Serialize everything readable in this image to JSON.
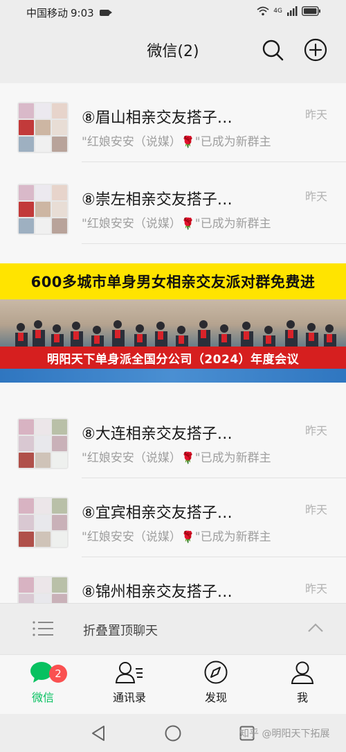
{
  "status_bar": {
    "carrier": "中国移动",
    "time": "9:03",
    "network": "4G"
  },
  "header": {
    "title": "微信(2)"
  },
  "chats": [
    {
      "name": "⑧眉山相亲交友搭子…",
      "time": "昨天",
      "preview_prefix": "\"红娘安安（说媒）",
      "preview_suffix": "\"已成为新群主"
    },
    {
      "name": "⑧崇左相亲交友搭子…",
      "time": "昨天",
      "preview_prefix": "\"红娘安安（说媒）",
      "preview_suffix": "\"已成为新群主"
    },
    {
      "name": "⑧大连相亲交友搭子…",
      "time": "昨天",
      "preview_prefix": "\"红娘安安（说媒）",
      "preview_suffix": "\"已成为新群主"
    },
    {
      "name": "⑧宜宾相亲交友搭子…",
      "time": "昨天",
      "preview_prefix": "\"红娘安安（说媒）",
      "preview_suffix": "\"已成为新群主"
    },
    {
      "name": "⑧锦州相亲交友搭子…",
      "time": "昨天",
      "preview_prefix": "",
      "preview_suffix": ""
    }
  ],
  "ad_banner": {
    "headline": "600多城市单身男女相亲交友派对群免费进",
    "caption": "明阳天下单身派全国分公司（2024）年度会议"
  },
  "folded_chats": {
    "label": "折叠置顶聊天"
  },
  "tabs": [
    {
      "label": "微信",
      "badge": "2",
      "icon": "chat-bubble-icon"
    },
    {
      "label": "通讯录",
      "icon": "contacts-icon"
    },
    {
      "label": "发现",
      "icon": "compass-icon"
    },
    {
      "label": "我",
      "icon": "person-icon"
    }
  ],
  "watermark": "知乎 @明阳天下拓展",
  "colors": {
    "accent_green": "#07c160",
    "badge_red": "#fa5151",
    "banner_yellow": "#ffe400",
    "banner_red": "#d61f1f",
    "background": "#ededed"
  }
}
